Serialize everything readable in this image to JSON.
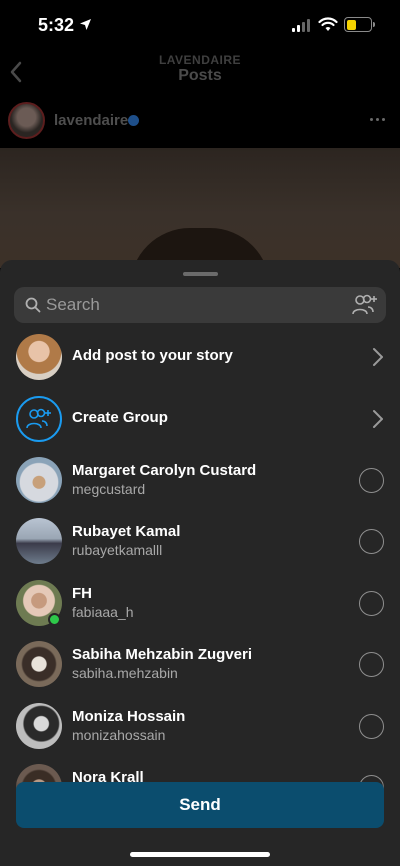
{
  "status_bar": {
    "time": "5:32"
  },
  "header": {
    "subtitle": "LAVENDAIRE",
    "title": "Posts"
  },
  "author": {
    "username": "lavendaire"
  },
  "search": {
    "placeholder": "Search"
  },
  "actions": [
    {
      "label": "Add post to your story"
    },
    {
      "label": "Create Group"
    }
  ],
  "contacts": [
    {
      "name": "Margaret Carolyn Custard",
      "handle": "megcustard",
      "avatar_color": "#8aa3b8"
    },
    {
      "name": "Rubayet Kamal",
      "handle": "rubayetkamalll",
      "avatar_color": "#6e7c8c"
    },
    {
      "name": "FH",
      "handle": "fabiaaa_h",
      "avatar_color": "#7a6a4e",
      "online": true
    },
    {
      "name": "Sabiha Mehzabin Zugveri",
      "handle": "sabiha.mehzabin",
      "avatar_color": "#5d5247"
    },
    {
      "name": "Moniza Hossain",
      "handle": "monizahossain",
      "avatar_color": "#9a9a9a"
    },
    {
      "name": "Nora Krall",
      "handle": "",
      "avatar_color": "#6b5a50"
    }
  ],
  "send_button": {
    "label": "Send"
  },
  "colors": {
    "accent": "#0b4d6e",
    "group_ring": "#1a9bf0",
    "online": "#2ec94a",
    "sheet_bg": "#262626"
  }
}
